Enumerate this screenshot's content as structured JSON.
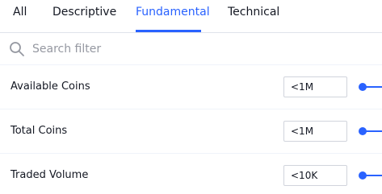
{
  "tabs": [
    {
      "label": "All",
      "active": false
    },
    {
      "label": "Descriptive",
      "active": false
    },
    {
      "label": "Fundamental",
      "active": true
    },
    {
      "label": "Technical",
      "active": false
    }
  ],
  "search": {
    "placeholder": "Search filter",
    "icon": "search-icon"
  },
  "filters": [
    {
      "label": "Available Coins",
      "value": "<1M"
    },
    {
      "label": "Total Coins",
      "value": "<1M"
    },
    {
      "label": "Traded Volume",
      "value": "<10K"
    }
  ],
  "colors": {
    "accent": "#2962ff",
    "text": "#131722",
    "placeholder": "#9598a1",
    "border": "#d1d4dc"
  }
}
